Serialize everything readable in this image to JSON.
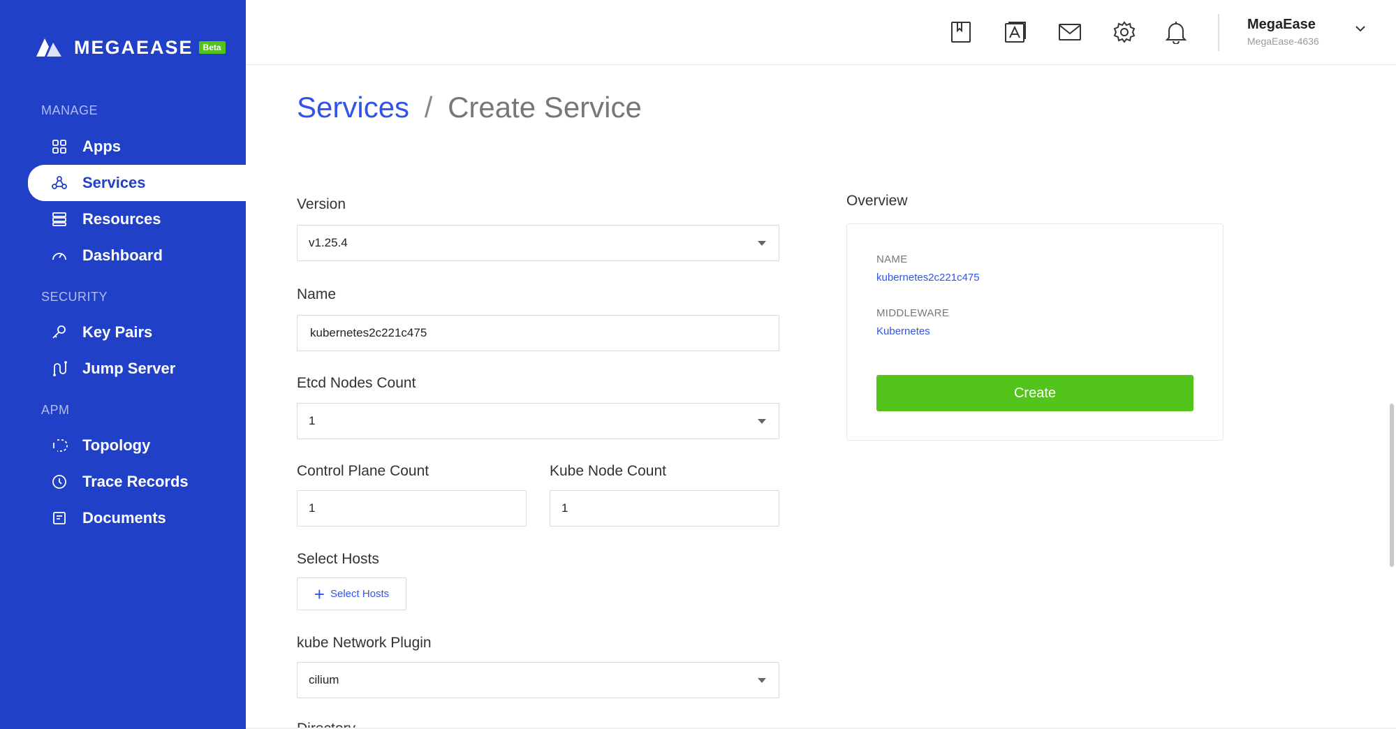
{
  "brand": {
    "name": "MEGAEASE",
    "badge": "Beta",
    "accent": "#2140c8",
    "badge_color": "#52c41a"
  },
  "sidebar": {
    "sections": [
      {
        "label": "MANAGE",
        "items": [
          {
            "label": "Apps",
            "icon": "apps-icon"
          },
          {
            "label": "Services",
            "icon": "services-icon",
            "active": true
          },
          {
            "label": "Resources",
            "icon": "resources-icon"
          },
          {
            "label": "Dashboard",
            "icon": "dashboard-icon"
          }
        ]
      },
      {
        "label": "SECURITY",
        "items": [
          {
            "label": "Key Pairs",
            "icon": "key-icon"
          },
          {
            "label": "Jump Server",
            "icon": "jump-server-icon"
          }
        ]
      },
      {
        "label": "APM",
        "items": [
          {
            "label": "Topology",
            "icon": "topology-icon"
          },
          {
            "label": "Trace Records",
            "icon": "clock-icon"
          },
          {
            "label": "Documents",
            "icon": "document-icon"
          }
        ]
      }
    ]
  },
  "header": {
    "icons": [
      "bookmark-icon",
      "contacts-icon",
      "mail-icon",
      "settings-icon",
      "bell-icon"
    ],
    "user": {
      "name": "MegaEase",
      "account": "MegaEase-4636"
    }
  },
  "breadcrumb": {
    "parent": "Services",
    "separator": "/",
    "current": "Create Service"
  },
  "form": {
    "version": {
      "label": "Version",
      "value": "v1.25.4"
    },
    "name": {
      "label": "Name",
      "value": "kubernetes2c221c475"
    },
    "etcd": {
      "label": "Etcd Nodes Count",
      "value": "1"
    },
    "control_plane": {
      "label": "Control Plane Count",
      "value": "1"
    },
    "kube_node": {
      "label": "Kube Node Count",
      "value": "1"
    },
    "hosts": {
      "label": "Select Hosts",
      "button": "Select Hosts"
    },
    "network": {
      "label": "kube Network Plugin",
      "value": "cilium"
    },
    "directory": {
      "label": "Directory"
    }
  },
  "overview": {
    "title": "Overview",
    "name_label": "NAME",
    "name_value": "kubernetes2c221c475",
    "middleware_label": "MIDDLEWARE",
    "middleware_value": "Kubernetes",
    "create_button": "Create",
    "button_color": "#52c41a"
  }
}
